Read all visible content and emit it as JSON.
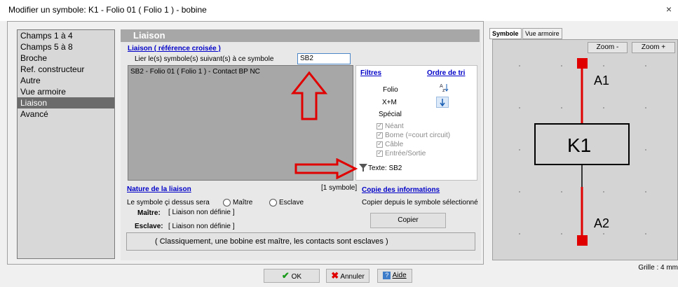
{
  "window": {
    "title": "Modifier un symbole: K1 - Folio 01 ( Folio 1 ) - bobine",
    "close_glyph": "×"
  },
  "sidebar": {
    "items": [
      "Champs 1 à 4",
      "Champs 5 à 8",
      "Broche",
      "Ref. constructeur",
      "Autre",
      "Vue armoire",
      "Liaison",
      "Avancé"
    ],
    "selected": "Liaison"
  },
  "panel": {
    "heading": "Liaison",
    "cross_ref_title": "Liaison ( référence croisée )",
    "link_label": "Lier le(s) symbole(s) suivant(s) à ce symbole",
    "link_value": "SB2",
    "list_items": [
      "SB2 - Folio 01 ( Folio 1 ) - Contact BP NC"
    ],
    "count": "[1 symbole]"
  },
  "filters": {
    "title": "Filtres",
    "sort_title": "Ordre de tri",
    "folio": "Folio",
    "xm": "X+M",
    "special": "Spécial",
    "checks": [
      "Néant",
      "Borne (=court circuit)",
      "Câble",
      "Entrée/Sortie"
    ],
    "text_filter": "Texte: SB2"
  },
  "nature": {
    "title": "Nature de la liaison",
    "prompt": "Le symbole çi dessus sera",
    "master_option": "Maître",
    "slave_option": "Esclave",
    "master_label": "Maître:",
    "master_value": "[ Liaison non définie ]",
    "slave_label": "Esclave:",
    "slave_value": "[ Liaison non définie ]"
  },
  "copy": {
    "title": "Copie des informations",
    "desc": "Copier depuis le symbole sélectionné",
    "button": "Copier"
  },
  "note": "( Classiquement, une bobine est maître, les contacts sont esclaves )",
  "buttons": {
    "ok": "OK",
    "cancel": "Annuler",
    "help": "Aide"
  },
  "preview": {
    "tabs": [
      "Symbole",
      "Vue armoire"
    ],
    "zoom_minus": "Zoom -",
    "zoom_plus": "Zoom +",
    "label_top": "A1",
    "label_center": "K1",
    "label_bottom": "A2",
    "grid": "Grille : 4 mm"
  },
  "colors": {
    "accent_red": "#e00000",
    "link_blue": "#0000c8",
    "heading_grey": "#a7a7a7"
  }
}
